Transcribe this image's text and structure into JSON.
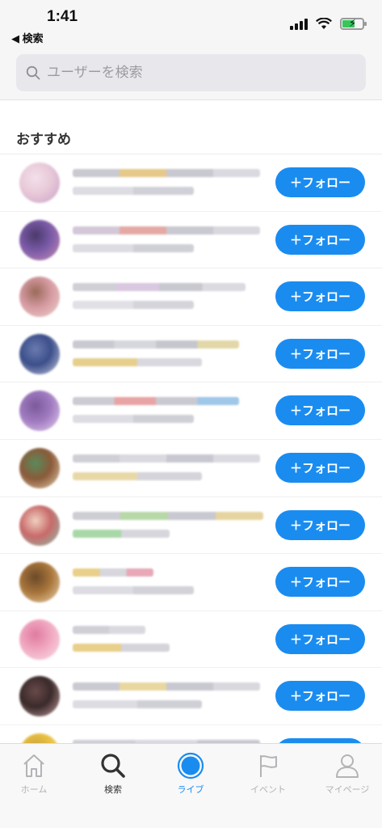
{
  "status_bar": {
    "time": "1:41",
    "back_label": "◀ 検索"
  },
  "search": {
    "placeholder": "ユーザーを検索"
  },
  "section": {
    "title": "おすすめ"
  },
  "follow_label": "＋フォロー",
  "users": [
    {
      "avatar_colors": [
        "#e8c9d8",
        "#c9a0c8",
        "#f3e0ea"
      ],
      "line1": [
        "#c9c9d2",
        "#e6c98a",
        "#c8c8d0",
        "#d9d9df"
      ],
      "line2": [
        "#dcdce2",
        "#d0d0d8"
      ]
    },
    {
      "avatar_colors": [
        "#7b5aa8",
        "#c88fb3",
        "#4a3a6a"
      ],
      "line1": [
        "#d4c8d8",
        "#e5a9a4",
        "#c9c9d2",
        "#d8d8de"
      ],
      "line2": [
        "#dcdce2",
        "#cfcfd6"
      ]
    },
    {
      "avatar_colors": [
        "#d59aa1",
        "#f0d4cf",
        "#9a6a5a"
      ],
      "line1": [
        "#cfcfd6",
        "#d9c8e0",
        "#c8c8d0",
        "#dadae0"
      ],
      "line2": [
        "#e0e0e5",
        "#d4d4da"
      ]
    },
    {
      "avatar_colors": [
        "#3c4f8a",
        "#c9cde0",
        "#6a7bb0"
      ],
      "line1": [
        "#c9c9d1",
        "#d6d6dd",
        "#c6c6ce",
        "#e2d7a8"
      ],
      "line2": [
        "#e6cf8c",
        "#d8d8de"
      ]
    },
    {
      "avatar_colors": [
        "#a07ac0",
        "#e6d2ef",
        "#7a5a9a"
      ],
      "line1": [
        "#cccbd3",
        "#e8a4a4",
        "#c9c9d1",
        "#9fc7e8"
      ],
      "line2": [
        "#dcdce2",
        "#cfcfd6"
      ]
    },
    {
      "avatar_colors": [
        "#8a5a3a",
        "#e8d2b0",
        "#5a8a5a"
      ],
      "line1": [
        "#cfcfd6",
        "#d9d9df",
        "#c8c8d0",
        "#dadae0"
      ],
      "line2": [
        "#e8d8a8",
        "#d4d4da"
      ]
    },
    {
      "avatar_colors": [
        "#c86a6a",
        "#8ac0a8",
        "#f0d0c0"
      ],
      "line1": [
        "#cdcdd4",
        "#b8d8a8",
        "#c8c8d0",
        "#e6d4a0"
      ],
      "line2": [
        "#a8d8a8",
        "#d6d6dc"
      ]
    },
    {
      "avatar_colors": [
        "#a8743a",
        "#f0d8b0",
        "#6a4a2a"
      ],
      "line1": [
        "#e8cf8a",
        "#d6d6dc",
        "#e8a8b8"
      ],
      "line2": [
        "#dcdce2",
        "#d2d2d8"
      ]
    },
    {
      "avatar_colors": [
        "#f0a8c0",
        "#fbe0ea",
        "#e07aa0"
      ],
      "line1": [
        "#cfcfd6",
        "#d9d9df"
      ],
      "line2": [
        "#e8cf8a",
        "#d4d4da"
      ]
    },
    {
      "avatar_colors": [
        "#3a2a2a",
        "#c8a0a0",
        "#6a4a4a"
      ],
      "line1": [
        "#cacad2",
        "#e8d8a0",
        "#c8c8d0",
        "#d8d8de"
      ],
      "line2": [
        "#dcdce2",
        "#cfcfd6"
      ]
    },
    {
      "avatar_colors": [
        "#e8c040",
        "#f0e0a0",
        "#c8a040"
      ],
      "line1": [
        "#cfcfd6",
        "#d9d9df",
        "#c8c8d0"
      ],
      "line2": [
        "#dcdce2"
      ]
    }
  ],
  "tabs": [
    {
      "label": "ホーム",
      "icon": "home-icon"
    },
    {
      "label": "検索",
      "icon": "search-icon"
    },
    {
      "label": "ライブ",
      "icon": "live-icon"
    },
    {
      "label": "イベント",
      "icon": "flag-icon"
    },
    {
      "label": "マイページ",
      "icon": "person-icon"
    }
  ],
  "colors": {
    "accent": "#1a8cf0",
    "battery": "#34c759"
  }
}
